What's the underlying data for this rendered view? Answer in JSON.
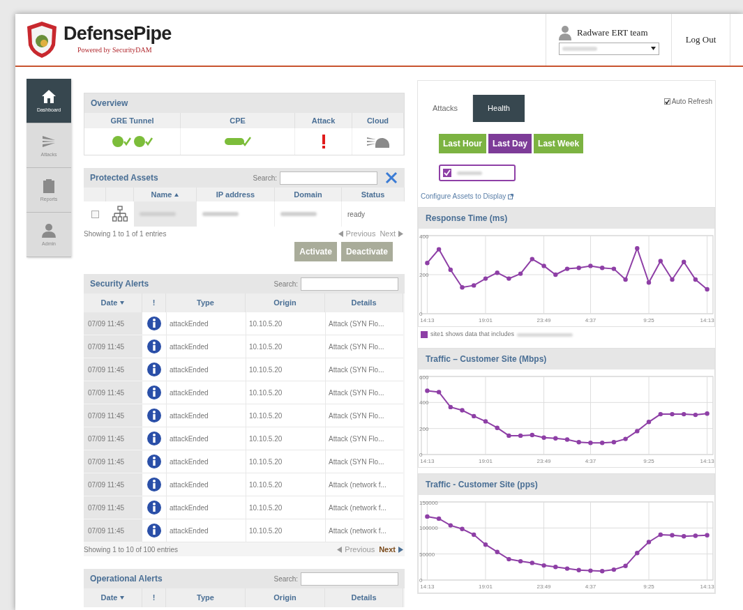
{
  "header": {
    "logo_title": "DefensePipe",
    "logo_tagline": "Powered by SecurityDAM",
    "user": "Radware ERT team",
    "logout": "Log Out"
  },
  "sidebar": {
    "items": [
      {
        "label": "Dashboard",
        "selected": true
      },
      {
        "label": "Attacks",
        "selected": false
      },
      {
        "label": "Reports",
        "selected": false
      },
      {
        "label": "Admin",
        "selected": false
      }
    ]
  },
  "overview": {
    "title": "Overview",
    "columns": [
      "GRE Tunnel",
      "CPE",
      "Attack",
      "Cloud"
    ]
  },
  "protected_assets": {
    "title": "Protected Assets",
    "search_label": "Search:",
    "columns": [
      "Name",
      "IP address",
      "Domain",
      "Status"
    ],
    "rows": [
      {
        "checked": false,
        "status": "ready"
      }
    ],
    "info": "Showing 1 to 1 of 1 entries",
    "prev": {
      "label": "Previous",
      "disabled": true
    },
    "next": {
      "label": "Next",
      "disabled": true
    },
    "buttons": [
      {
        "label": "Activate",
        "disabled": true
      },
      {
        "label": "Deactivate",
        "disabled": true
      }
    ]
  },
  "security_alerts": {
    "title": "Security Alerts",
    "search_label": "Search:",
    "columns": [
      "Date",
      "!",
      "Type",
      "Origin",
      "Details"
    ],
    "rows": [
      {
        "date": "07/09 11:45",
        "type": "attackEnded",
        "origin": "10.10.5.20",
        "details": "Attack (SYN Flo..."
      },
      {
        "date": "07/09 11:45",
        "type": "attackEnded",
        "origin": "10.10.5.20",
        "details": "Attack (SYN Flo..."
      },
      {
        "date": "07/09 11:45",
        "type": "attackEnded",
        "origin": "10.10.5.20",
        "details": "Attack (SYN Flo..."
      },
      {
        "date": "07/09 11:45",
        "type": "attackEnded",
        "origin": "10.10.5.20",
        "details": "Attack (SYN Flo..."
      },
      {
        "date": "07/09 11:45",
        "type": "attackEnded",
        "origin": "10.10.5.20",
        "details": "Attack (SYN Flo..."
      },
      {
        "date": "07/09 11:45",
        "type": "attackEnded",
        "origin": "10.10.5.20",
        "details": "Attack (SYN Flo..."
      },
      {
        "date": "07/09 11:45",
        "type": "attackEnded",
        "origin": "10.10.5.20",
        "details": "Attack (SYN Flo..."
      },
      {
        "date": "07/09 11:45",
        "type": "attackEnded",
        "origin": "10.10.5.20",
        "details": "Attack (network f..."
      },
      {
        "date": "07/09 11:45",
        "type": "attackEnded",
        "origin": "10.10.5.20",
        "details": "Attack (network f..."
      },
      {
        "date": "07/09 11:45",
        "type": "attackEnded",
        "origin": "10.10.5.20",
        "details": "Attack (network f..."
      }
    ],
    "info": "Showing 1 to 10 of 100 entries",
    "prev": {
      "label": "Previous",
      "disabled": true
    },
    "next": {
      "label": "Next",
      "disabled": false
    }
  },
  "operational_alerts": {
    "title": "Operational Alerts",
    "search_label": "Search:",
    "columns": [
      "Date",
      "!",
      "Type",
      "Origin",
      "Details"
    ]
  },
  "health": {
    "tabs": [
      {
        "label": "Attacks",
        "selected": false
      },
      {
        "label": "Health",
        "selected": true
      }
    ],
    "auto_refresh": {
      "label": "Auto Refresh",
      "checked": true
    },
    "periods": [
      {
        "label": "Last Hour",
        "selected": false
      },
      {
        "label": "Last Day",
        "selected": true
      },
      {
        "label": "Last Week",
        "selected": false
      }
    ],
    "asset_chip": {
      "checked": true,
      "color": "#8e3fa6"
    },
    "configure_link": "Configure Assets to Display",
    "legend": "site1 shows data that includes",
    "charts": [
      {
        "title": "Response Time (ms)",
        "chart_data": {
          "type": "line",
          "categories": [
            "14:13",
            null,
            null,
            null,
            null,
            "19:01",
            null,
            null,
            null,
            null,
            "23:49",
            null,
            null,
            null,
            "4:37",
            null,
            null,
            null,
            null,
            "9:25",
            null,
            null,
            null,
            null,
            "14:13"
          ],
          "series": [
            {
              "color": "#8e3fa6",
              "marker": "o",
              "values": [
                260,
                330,
                225,
                135,
                145,
                180,
                210,
                180,
                205,
                280,
                245,
                200,
                230,
                235,
                245,
                235,
                230,
                175,
                335,
                160,
                270,
                175,
                265,
                175,
                125
              ]
            }
          ],
          "ylim": [
            0,
            400
          ],
          "yticks": [
            0,
            200,
            400
          ],
          "grid": true
        }
      },
      {
        "title": "Traffic – Customer Site (Mbps)",
        "chart_data": {
          "type": "line",
          "categories": [
            "14:13",
            null,
            null,
            null,
            null,
            "19:01",
            null,
            null,
            null,
            null,
            "23:49",
            null,
            null,
            null,
            "4:37",
            null,
            null,
            null,
            null,
            "9:25",
            null,
            null,
            null,
            null,
            "14:13"
          ],
          "series": [
            {
              "color": "#8e3fa6",
              "marker": "o",
              "values": [
                490,
                480,
                365,
                340,
                295,
                255,
                205,
                145,
                145,
                150,
                130,
                125,
                115,
                95,
                90,
                90,
                95,
                120,
                180,
                250,
                310,
                310,
                310,
                305,
                315
              ]
            }
          ],
          "ylim": [
            0,
            600
          ],
          "yticks": [
            0,
            200,
            400,
            600
          ],
          "grid": true
        }
      },
      {
        "title": "Traffic - Customer Site (pps)",
        "chart_data": {
          "type": "line",
          "categories": [
            "14:13",
            null,
            null,
            null,
            null,
            "19:01",
            null,
            null,
            null,
            null,
            "23:49",
            null,
            null,
            null,
            "4:37",
            null,
            null,
            null,
            null,
            "9:25",
            null,
            null,
            null,
            null,
            "14:13"
          ],
          "series": [
            {
              "color": "#8e3fa6",
              "marker": "o",
              "values": [
                122000,
                118000,
                105000,
                98000,
                87000,
                68000,
                54000,
                40000,
                36000,
                33000,
                28000,
                25000,
                22000,
                19000,
                18000,
                17000,
                20000,
                27000,
                52000,
                73000,
                87000,
                86000,
                84000,
                85000,
                86000
              ]
            }
          ],
          "ylim": [
            0,
            150000
          ],
          "yticks": [
            0,
            50000,
            100000,
            150000
          ],
          "grid": true
        }
      }
    ]
  }
}
